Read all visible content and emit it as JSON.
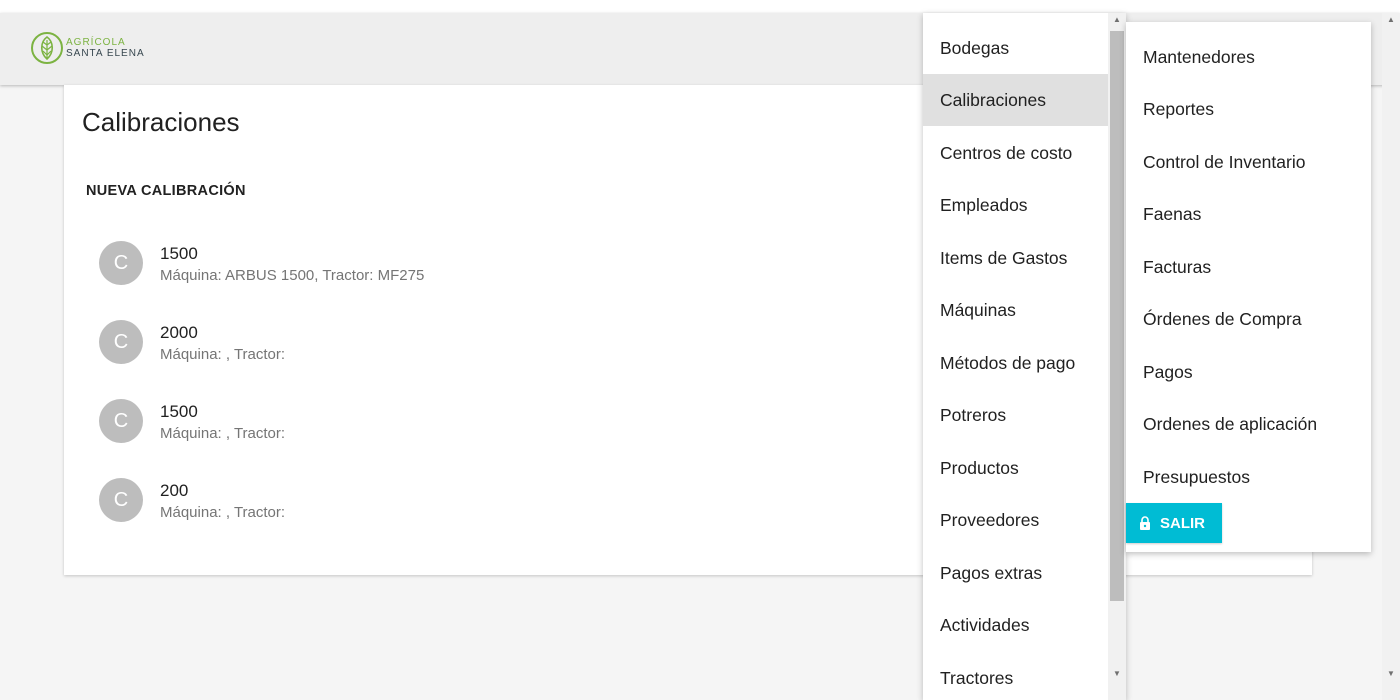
{
  "logo": {
    "line1": "AGRÍCOLA",
    "line2": "SANTA ELENA",
    "icon": "leaf-icon",
    "colors": {
      "green": "#7cb342",
      "dark": "#37474f"
    }
  },
  "page": {
    "title": "Calibraciones",
    "new_button": "NUEVA CALIBRACIÓN",
    "items": [
      {
        "avatar": "C",
        "title": "1500",
        "subtitle": "Máquina: ARBUS 1500, Tractor: MF275"
      },
      {
        "avatar": "C",
        "title": "2000",
        "subtitle": "Máquina: , Tractor:"
      },
      {
        "avatar": "C",
        "title": "1500",
        "subtitle": "Máquina: , Tractor:"
      },
      {
        "avatar": "C",
        "title": "200",
        "subtitle": "Máquina: , Tractor:"
      }
    ]
  },
  "menu_left": {
    "selected": "Calibraciones",
    "items": [
      "Bodegas",
      "Calibraciones",
      "Centros de costo",
      "Empleados",
      "Items de Gastos",
      "Máquinas",
      "Métodos de pago",
      "Potreros",
      "Productos",
      "Proveedores",
      "Pagos extras",
      "Actividades",
      "Tractores"
    ]
  },
  "menu_right": {
    "items": [
      "Mantenedores",
      "Reportes",
      "Control de Inventario",
      "Faenas",
      "Facturas",
      "Órdenes de Compra",
      "Pagos",
      "Ordenes de aplicación",
      "Presupuestos"
    ],
    "logout_label": "SALIR",
    "logout_icon": "lock-icon",
    "accent": "#00bcd4"
  },
  "scroll_arrows": {
    "up": "▲",
    "down": "▼"
  }
}
